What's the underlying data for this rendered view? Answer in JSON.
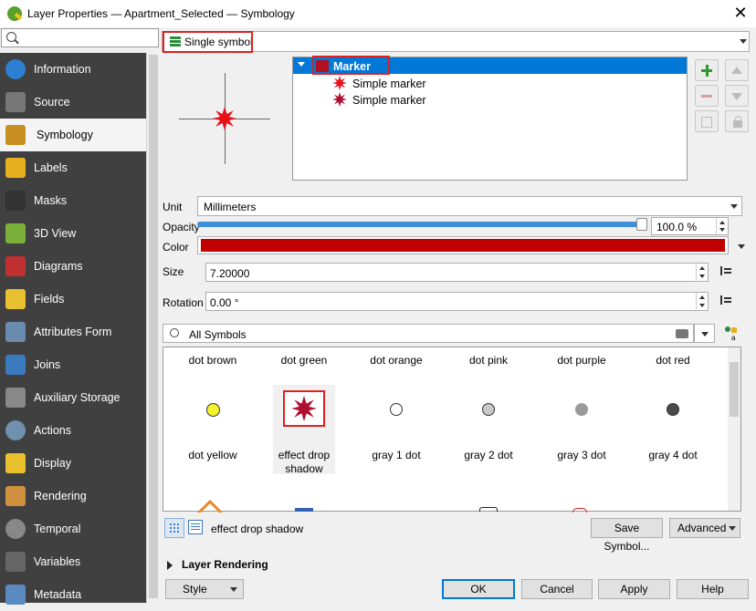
{
  "window": {
    "title": "Layer Properties — Apartment_Selected — Symbology",
    "close_label": "✕"
  },
  "sidebar": {
    "search_placeholder": "",
    "items": [
      {
        "label": "Information",
        "icon": "info-icon"
      },
      {
        "label": "Source",
        "icon": "source-icon"
      },
      {
        "label": "Symbology",
        "icon": "symbology-brush-icon",
        "selected": true
      },
      {
        "label": "Labels",
        "icon": "labels-abc-icon"
      },
      {
        "label": "Masks",
        "icon": "masks-abc-icon"
      },
      {
        "label": "3D View",
        "icon": "3d-cube-icon"
      },
      {
        "label": "Diagrams",
        "icon": "diagrams-icon"
      },
      {
        "label": "Fields",
        "icon": "fields-icon"
      },
      {
        "label": "Attributes Form",
        "icon": "attributes-form-icon"
      },
      {
        "label": "Joins",
        "icon": "joins-icon"
      },
      {
        "label": "Auxiliary Storage",
        "icon": "auxiliary-storage-icon"
      },
      {
        "label": "Actions",
        "icon": "actions-gear-icon"
      },
      {
        "label": "Display",
        "icon": "display-bubble-icon"
      },
      {
        "label": "Rendering",
        "icon": "rendering-brush-icon"
      },
      {
        "label": "Temporal",
        "icon": "temporal-clock-icon"
      },
      {
        "label": "Variables",
        "icon": "variables-icon"
      },
      {
        "label": "Metadata",
        "icon": "metadata-icon"
      }
    ]
  },
  "renderer": {
    "label": "Single symbol"
  },
  "symbol_tree": {
    "root": "Marker",
    "layers": [
      {
        "label": "Simple marker"
      },
      {
        "label": "Simple marker"
      }
    ]
  },
  "properties": {
    "unit_label": "Unit",
    "unit_value": "Millimeters",
    "opacity_label": "Opacity",
    "opacity_value": "100.0 %",
    "opacity_fraction": 1.0,
    "color_label": "Color",
    "color_value": "#c00000",
    "size_label": "Size",
    "size_value": "7.20000",
    "rotation_label": "Rotation",
    "rotation_value": "0.00 °"
  },
  "symbol_search": {
    "value": "All Symbols"
  },
  "gallery": {
    "row1": [
      "dot brown",
      "dot green",
      "dot orange",
      "dot pink",
      "dot purple",
      "dot red"
    ],
    "row2": [
      {
        "name": "dot yellow",
        "color": "#f5f22e"
      },
      {
        "name": "effect drop\nshadow",
        "color": "#b01030",
        "selected": true
      },
      {
        "name": "gray 1 dot",
        "color": "#ffffff"
      },
      {
        "name": "gray 2 dot",
        "color": "#c8c8c8"
      },
      {
        "name": "gray 3 dot",
        "color": "#9a9a9a"
      },
      {
        "name": "gray 4 dot",
        "color": "#4a4a4a"
      }
    ]
  },
  "gallery_footer": {
    "current_name": "effect drop shadow",
    "save_label": "Save Symbol...",
    "advanced_label": "Advanced"
  },
  "layer_rendering": {
    "label": "Layer Rendering"
  },
  "buttons": {
    "style": "Style",
    "ok": "OK",
    "cancel": "Cancel",
    "apply": "Apply",
    "help": "Help"
  },
  "colors": {
    "accent": "#0078d7",
    "highlight": "#e02020",
    "sidebar_bg": "#404040"
  }
}
